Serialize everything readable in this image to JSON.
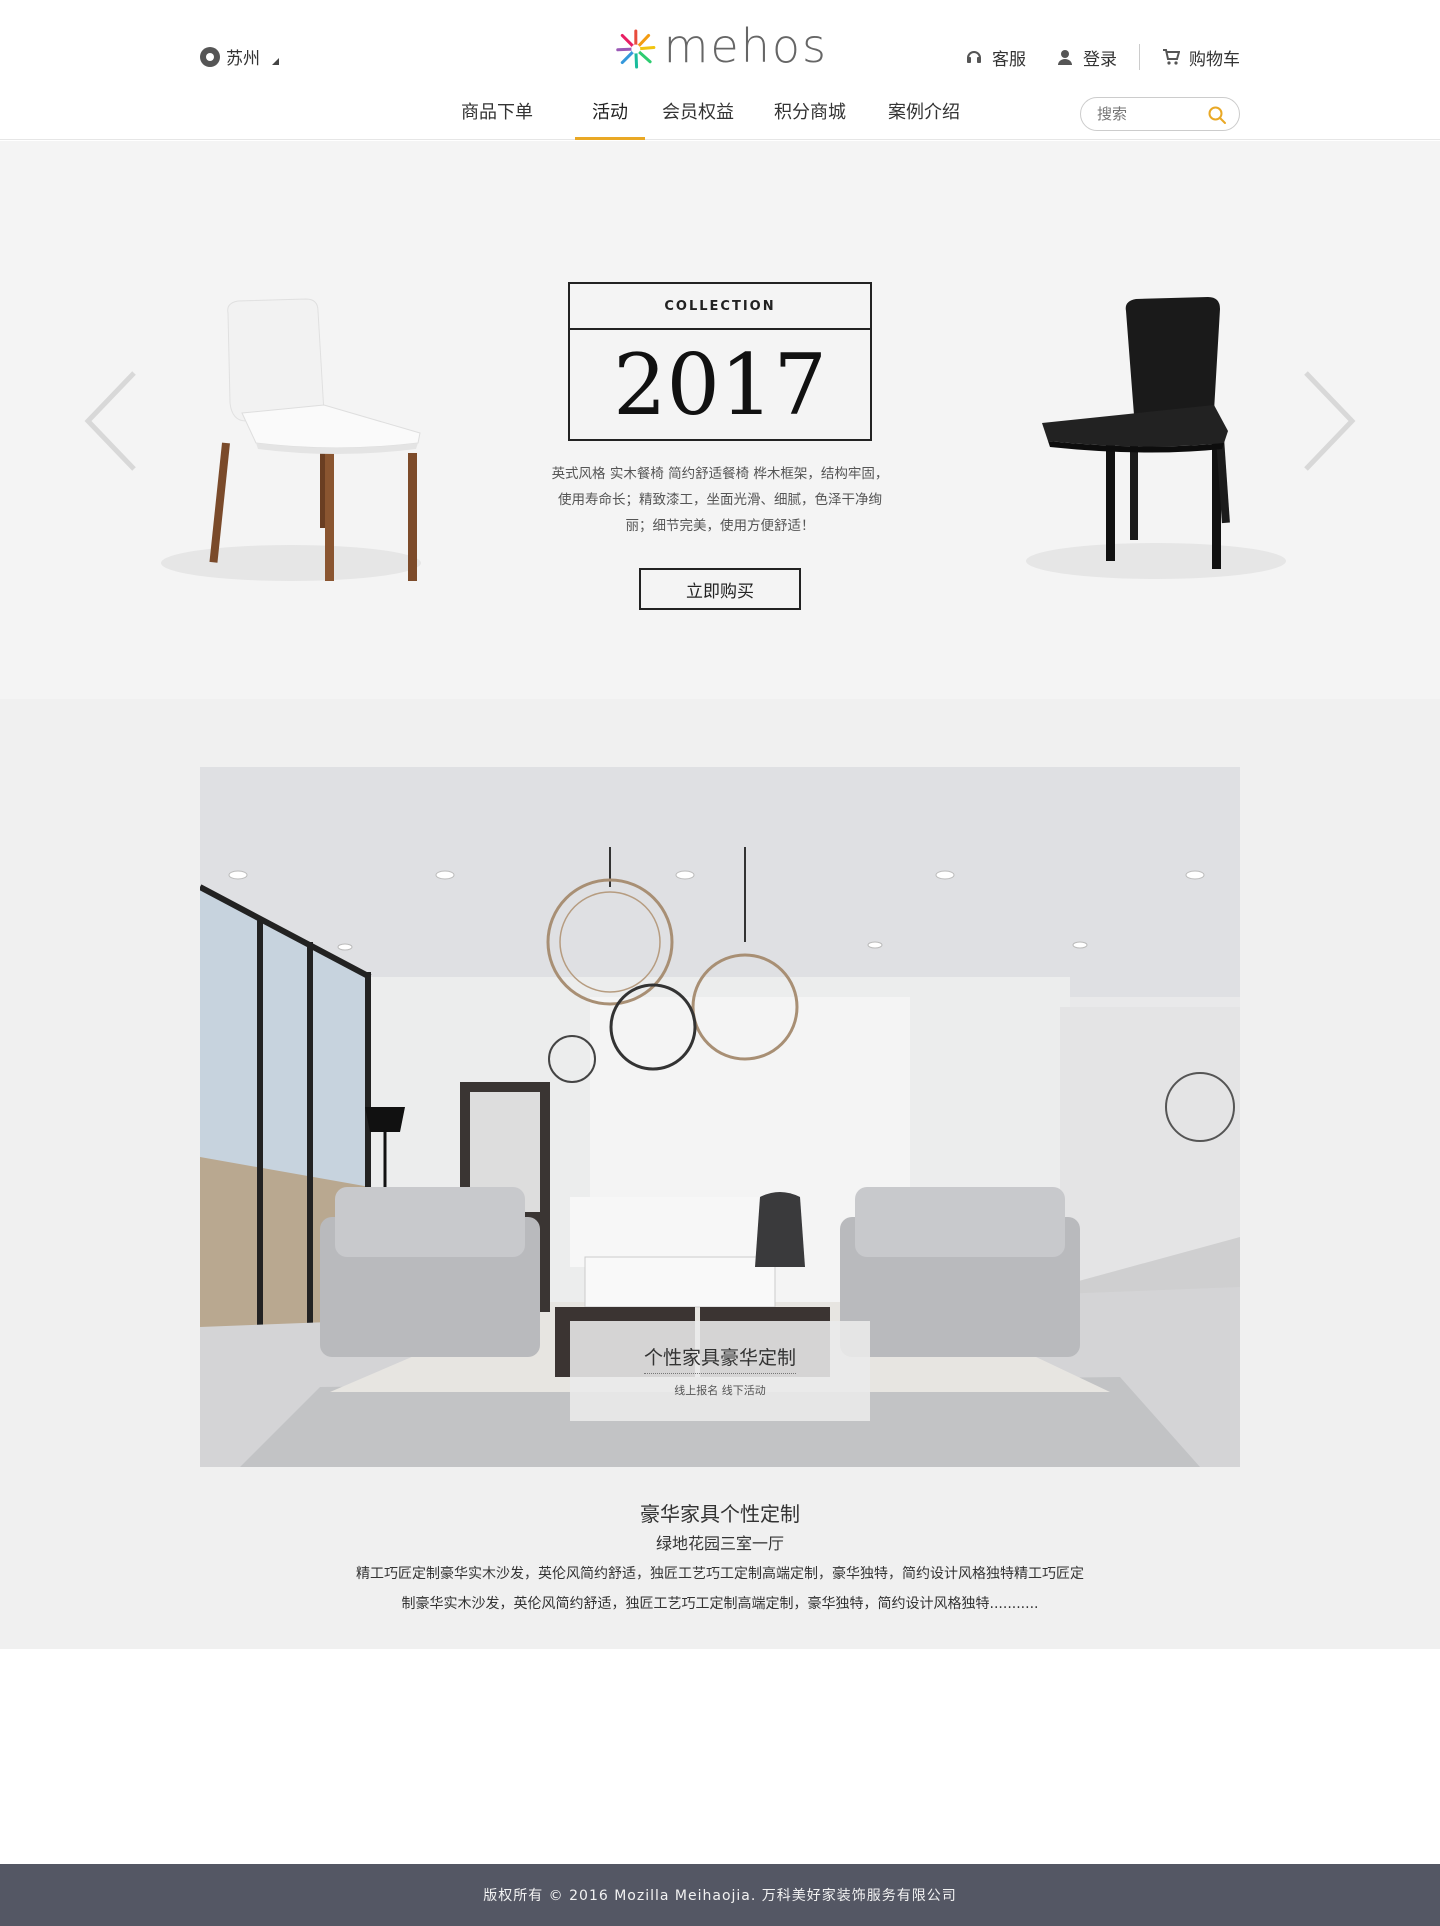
{
  "header": {
    "city": "苏州",
    "logo_text": "mehos",
    "links": {
      "service": "客服",
      "login": "登录",
      "cart": "购物车"
    },
    "nav": [
      {
        "label": "商品下单"
      },
      {
        "label": "活动"
      },
      {
        "label": "会员权益"
      },
      {
        "label": "积分商城"
      },
      {
        "label": "案例介绍"
      }
    ],
    "active_nav": "活动",
    "search_placeholder": "搜索",
    "accent_color": "#e9a825"
  },
  "hero": {
    "collection_label": "COLLECTION",
    "year": "2017",
    "description": "英式风格 实木餐椅 简约舒适餐椅  桦木框架，结构牢固，使用寿命长；精致漆工，坐面光滑、细腻，色泽干净绚丽；细节完美，使用方便舒适！",
    "buy_label": "立即购买"
  },
  "feature": {
    "overlay_title": "个性家具豪华定制",
    "overlay_sub": "线上报名 线下活动",
    "title": "豪华家具个性定制",
    "subtitle": "绿地花园三室一厅",
    "description": "精工巧匠定制豪华实木沙发，英伦风简约舒适，独匠工艺巧工定制高端定制，豪华独特，简约设计风格独特精工巧匠定制豪华实木沙发，英伦风简约舒适，独匠工艺巧工定制高端定制，豪华独特，简约设计风格独特..........."
  },
  "footer": {
    "copyright": "版权所有 © 2016 Mozilla Meihaojia. 万科美好家装饰服务有限公司"
  }
}
